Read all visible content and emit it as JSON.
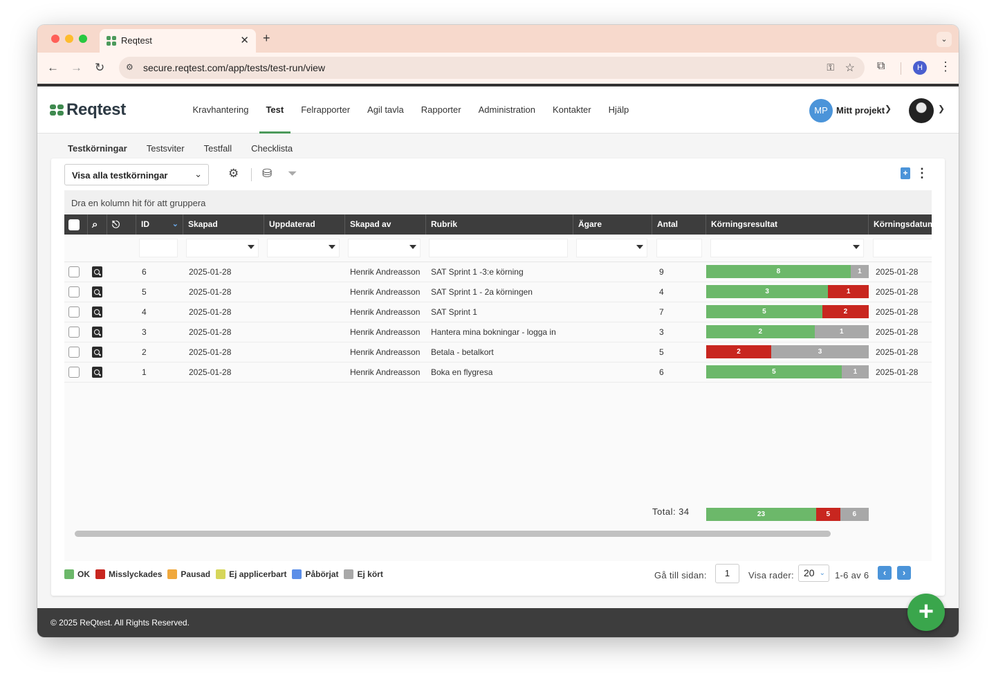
{
  "browser": {
    "tab_title": "Reqtest",
    "url": "secure.reqtest.com/app/tests/test-run/view",
    "profile_initial": "H"
  },
  "app": {
    "logo_text": "Reqtest",
    "nav": [
      {
        "label": "Kravhantering",
        "active": false
      },
      {
        "label": "Test",
        "active": true
      },
      {
        "label": "Felrapporter",
        "active": false
      },
      {
        "label": "Agil tavla",
        "active": false
      },
      {
        "label": "Rapporter",
        "active": false
      },
      {
        "label": "Administration",
        "active": false
      },
      {
        "label": "Kontakter",
        "active": false
      },
      {
        "label": "Hjälp",
        "active": false
      }
    ],
    "project_initials": "MP",
    "project_name": "Mitt projekt"
  },
  "subnav": [
    {
      "label": "Testkörningar",
      "active": true
    },
    {
      "label": "Testsviter",
      "active": false
    },
    {
      "label": "Testfall",
      "active": false
    },
    {
      "label": "Checklista",
      "active": false
    }
  ],
  "toolbar": {
    "view_select": "Visa alla testkörningar"
  },
  "grid": {
    "group_hint": "Dra en kolumn hit för att gruppera",
    "columns": [
      "ID",
      "Skapad",
      "Uppdaterad",
      "Skapad av",
      "Rubrik",
      "Ägare",
      "Antal",
      "Körningsresultat",
      "Körningsdatum"
    ],
    "rows": [
      {
        "id": "6",
        "created": "2025-01-28",
        "updated": "",
        "created_by": "Henrik Andreasson",
        "title": "SAT Sprint 1 -3:e körning",
        "owner": "",
        "count": "9",
        "result": {
          "ok": 8,
          "failed": 0,
          "not_run": 1
        },
        "run_date": "2025-01-28"
      },
      {
        "id": "5",
        "created": "2025-01-28",
        "updated": "",
        "created_by": "Henrik Andreasson",
        "title": "SAT Sprint 1 - 2a körningen",
        "owner": "",
        "count": "4",
        "result": {
          "ok": 3,
          "failed": 1,
          "not_run": 0
        },
        "run_date": "2025-01-28"
      },
      {
        "id": "4",
        "created": "2025-01-28",
        "updated": "",
        "created_by": "Henrik Andreasson",
        "title": "SAT Sprint 1",
        "owner": "",
        "count": "7",
        "result": {
          "ok": 5,
          "failed": 2,
          "not_run": 0
        },
        "run_date": "2025-01-28"
      },
      {
        "id": "3",
        "created": "2025-01-28",
        "updated": "",
        "created_by": "Henrik Andreasson",
        "title": "Hantera mina bokningar - logga in",
        "owner": "",
        "count": "3",
        "result": {
          "ok": 2,
          "failed": 0,
          "not_run": 1
        },
        "run_date": "2025-01-28"
      },
      {
        "id": "2",
        "created": "2025-01-28",
        "updated": "",
        "created_by": "Henrik Andreasson",
        "title": "Betala - betalkort",
        "owner": "",
        "count": "5",
        "result": {
          "ok": 0,
          "failed": 2,
          "not_run": 3
        },
        "run_date": "2025-01-28"
      },
      {
        "id": "1",
        "created": "2025-01-28",
        "updated": "",
        "created_by": "Henrik Andreasson",
        "title": "Boka en flygresa",
        "owner": "",
        "count": "6",
        "result": {
          "ok": 5,
          "failed": 0,
          "not_run": 1
        },
        "run_date": "2025-01-28"
      }
    ],
    "total_label": "Total: 34",
    "total_result": {
      "ok": 23,
      "failed": 5,
      "not_run": 6
    }
  },
  "colors": {
    "ok": "#6cb86a",
    "failed": "#c8261f",
    "paused": "#f0a83c",
    "not_applicable": "#d6d65a",
    "started": "#5b8ee8",
    "not_run": "#a8a8a8"
  },
  "legend": [
    {
      "label": "OK",
      "color": "#6cb86a"
    },
    {
      "label": "Misslyckades",
      "color": "#c8261f"
    },
    {
      "label": "Pausad",
      "color": "#f0a83c"
    },
    {
      "label": "Ej applicerbart",
      "color": "#d6d65a"
    },
    {
      "label": "Påbörjat",
      "color": "#5b8ee8"
    },
    {
      "label": "Ej kört",
      "color": "#a8a8a8"
    }
  ],
  "pager": {
    "goto_label": "Gå till sidan:",
    "page": "1",
    "rows_label": "Visa rader:",
    "rows_per_page": "20",
    "range": "1-6 av 6"
  },
  "footer": {
    "copyright": "© 2025 ReQtest. All Rights Reserved."
  }
}
